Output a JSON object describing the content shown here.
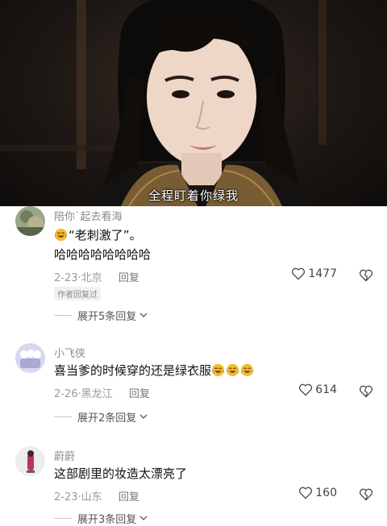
{
  "video": {
    "subtitle": "全程盯着你绿我"
  },
  "comments": [
    {
      "username": "陪你`起去看海",
      "lines": [
        "“老刺激了”。",
        "哈哈哈哈哈哈哈哈"
      ],
      "emoji_prefix": "laugh-cry",
      "date": "2-23",
      "location": "北京",
      "reply_label": "回复",
      "author_badge": "作者回复过",
      "likes": "1477",
      "expand_label": "展开5条回复"
    },
    {
      "username": "小飞侠",
      "lines": [
        "喜当爹的时候穿的还是绿衣服"
      ],
      "emoji_suffix_count": 3,
      "date": "2-26",
      "location": "黑龙江",
      "reply_label": "回复",
      "likes": "614",
      "expand_label": "展开2条回复"
    },
    {
      "username": "蔚蔚",
      "lines": [
        "这部剧里的妆造太漂亮了"
      ],
      "date": "2-23",
      "location": "山东",
      "reply_label": "回复",
      "likes": "160",
      "expand_label": "展开3条回复"
    }
  ],
  "colors": {
    "accent_gold": "#e8a93a",
    "text_primary": "#111111",
    "text_meta": "#9a9a9a"
  }
}
